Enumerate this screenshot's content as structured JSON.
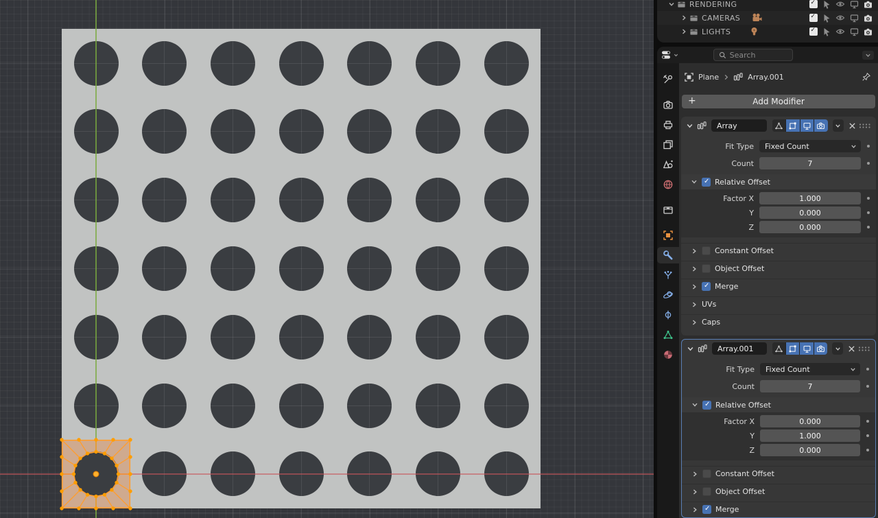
{
  "colors": {
    "accent_blue": "#4772b3",
    "active_outline": "#5a7fb5",
    "select_orange": "#ff9d2e",
    "plane_grey": "#c1c3c2",
    "hole_dark": "#3a3d41",
    "tan_icon": "#bd8458"
  },
  "outliner": {
    "rows": [
      {
        "label": "RENDERING",
        "icon": "collection-icon",
        "type_icon": null,
        "expanded": true
      },
      {
        "label": "CAMERAS",
        "icon": "collection-icon",
        "type_icon": "movie-camera-icon",
        "expanded": false
      },
      {
        "label": "LIGHTS",
        "icon": "collection-icon",
        "type_icon": "light-bulb-icon",
        "expanded": false
      }
    ],
    "row_controls": [
      "checkbox",
      "cursor-icon",
      "eye-icon",
      "monitor-icon",
      "camera-icon"
    ]
  },
  "properties": {
    "search_placeholder": "Search",
    "breadcrumb": {
      "object": "Plane",
      "modifier": "Array.001"
    },
    "add_modifier": "Add Modifier",
    "tabs": [
      {
        "icon": "tool-icon",
        "color": "#cfcfcf",
        "gap": false,
        "active": false
      },
      {
        "icon": "render-icon",
        "color": "#cfcfcf",
        "gap": true,
        "active": false
      },
      {
        "icon": "output-icon",
        "color": "#cfcfcf",
        "gap": false,
        "active": false
      },
      {
        "icon": "viewlayer-icon",
        "color": "#cfcfcf",
        "gap": false,
        "active": false
      },
      {
        "icon": "scene-icon",
        "color": "#cfcfcf",
        "gap": false,
        "active": false
      },
      {
        "icon": "world-icon",
        "color": "#cf6f72",
        "gap": false,
        "active": false
      },
      {
        "icon": "collection-icon",
        "color": "#cfcfcf",
        "gap": true,
        "active": false
      },
      {
        "icon": "object-icon",
        "color": "#e8913f",
        "gap": true,
        "active": false
      },
      {
        "icon": "modifier-icon",
        "color": "#84aee8",
        "gap": false,
        "active": true
      },
      {
        "icon": "particles-icon",
        "color": "#84aee8",
        "gap": false,
        "active": false
      },
      {
        "icon": "physics-icon",
        "color": "#84aee8",
        "gap": false,
        "active": false
      },
      {
        "icon": "constraints-icon",
        "color": "#84aee8",
        "gap": false,
        "active": false
      },
      {
        "icon": "data-icon",
        "color": "#3ec18a",
        "gap": false,
        "active": false
      },
      {
        "icon": "material-icon",
        "color": "#c96a74",
        "gap": false,
        "active": false
      }
    ]
  },
  "modifiers": [
    {
      "name": "Array",
      "active": false,
      "fields": {
        "fit_type_label": "Fit Type",
        "fit_type_value": "Fixed Count",
        "count_label": "Count",
        "count_value": "7"
      },
      "relative_offset": {
        "title": "Relative Offset",
        "checked": true,
        "rows": [
          {
            "label": "Factor X",
            "value": "1.000"
          },
          {
            "label": "Y",
            "value": "0.000"
          },
          {
            "label": "Z",
            "value": "0.000"
          }
        ]
      },
      "subpanels": [
        {
          "label": "Constant Offset",
          "has_checkbox": true,
          "checked": false
        },
        {
          "label": "Object Offset",
          "has_checkbox": true,
          "checked": false
        },
        {
          "label": "Merge",
          "has_checkbox": true,
          "checked": true
        },
        {
          "label": "UVs",
          "has_checkbox": false,
          "checked": false
        },
        {
          "label": "Caps",
          "has_checkbox": false,
          "checked": false
        }
      ]
    },
    {
      "name": "Array.001",
      "active": true,
      "fields": {
        "fit_type_label": "Fit Type",
        "fit_type_value": "Fixed Count",
        "count_label": "Count",
        "count_value": "7"
      },
      "relative_offset": {
        "title": "Relative Offset",
        "checked": true,
        "rows": [
          {
            "label": "Factor X",
            "value": "0.000"
          },
          {
            "label": "Y",
            "value": "1.000"
          },
          {
            "label": "Z",
            "value": "0.000"
          }
        ]
      },
      "subpanels": [
        {
          "label": "Constant Offset",
          "has_checkbox": true,
          "checked": false
        },
        {
          "label": "Object Offset",
          "has_checkbox": true,
          "checked": false
        },
        {
          "label": "Merge",
          "has_checkbox": true,
          "checked": true
        }
      ]
    }
  ],
  "viewport": {
    "grid_rows": 7,
    "grid_cols": 7,
    "selected_cell": {
      "row": 6,
      "col": 0
    },
    "hole_radius_px": 32.5,
    "cell_step_x": 99.67,
    "cell_step_y": 99.83
  }
}
